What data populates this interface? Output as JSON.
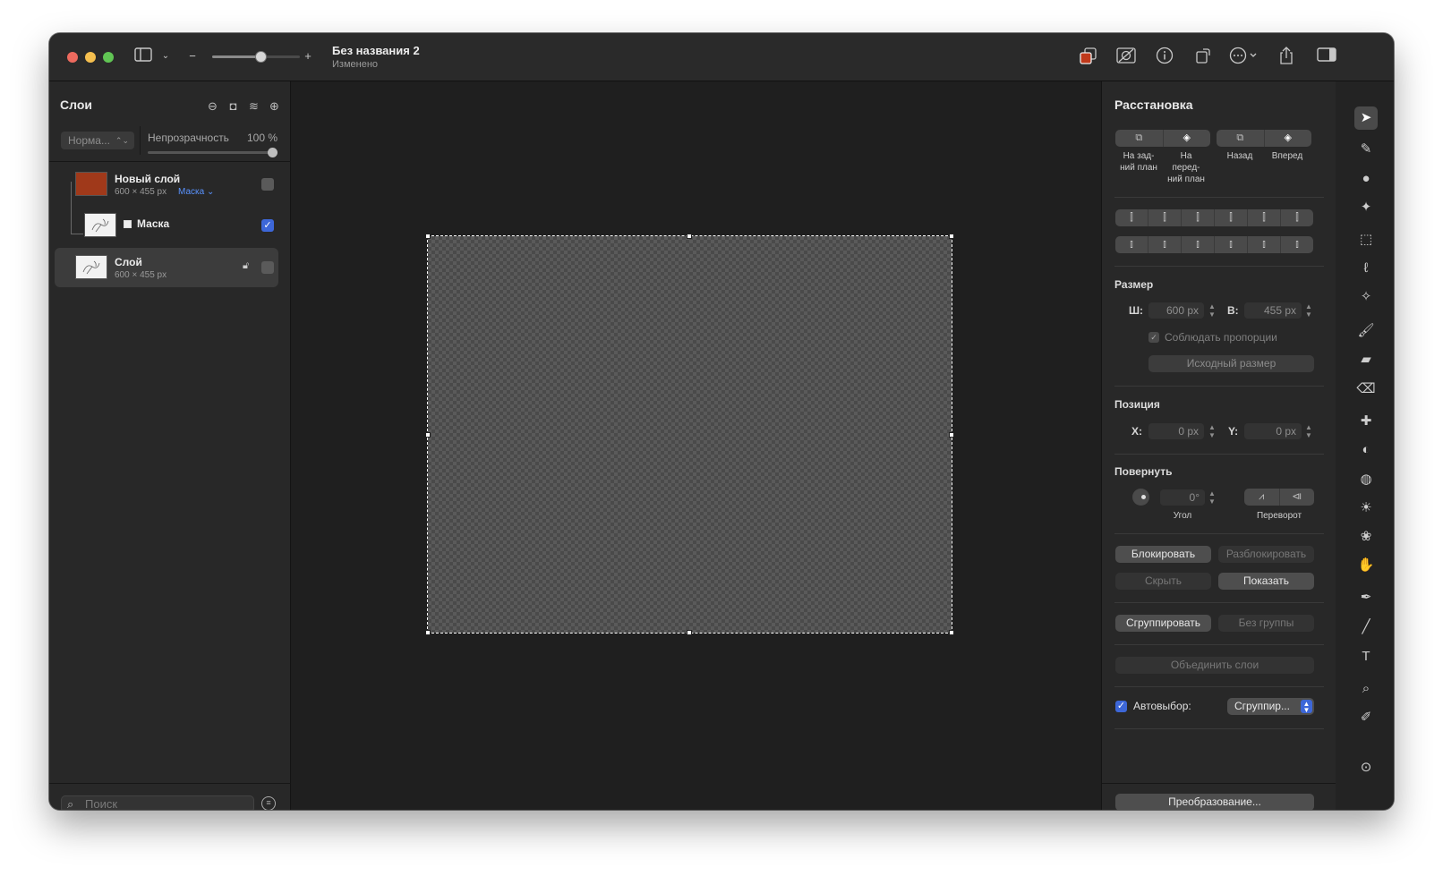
{
  "window": {
    "title": "Без названия 2",
    "subtitle": "Изменено"
  },
  "toolbar": {
    "zoom_minus": "−",
    "zoom_plus": "+",
    "zoom_level": 0.55,
    "icons": [
      "sidebar-icon",
      "chevron-down-icon",
      "color-icon",
      "adjust-image-icon",
      "info-icon",
      "rotate-icon",
      "more-icon",
      "share-icon",
      "inspector-icon"
    ]
  },
  "layers_panel": {
    "title": "Слои",
    "blend_mode": "Норма...",
    "opacity_label": "Непрозрачность",
    "opacity_value": "100 %",
    "layers": [
      {
        "name": "Новый слой",
        "size": "600 × 455 px",
        "mask_link": "Маска",
        "color": "#a0391a"
      },
      {
        "name": "Маска",
        "mask_icon": "◘"
      },
      {
        "name": "Слой",
        "size": "600 × 455 px"
      }
    ],
    "search_placeholder": "Поиск"
  },
  "arrange_panel": {
    "title": "Расстановка",
    "order_buttons": [
      {
        "label": "На зад-\nний план"
      },
      {
        "label": "На\nперед-\nний план"
      },
      {
        "label": "Назад"
      },
      {
        "label": "Вперед"
      }
    ],
    "size": {
      "label": "Размер",
      "w_label": "Ш:",
      "w_value": "600 px",
      "h_label": "В:",
      "h_value": "455 px",
      "keep_proportions": "Соблюдать пропорции",
      "original_size": "Исходный размер"
    },
    "position": {
      "label": "Позиция",
      "x_label": "X:",
      "x_value": "0 px",
      "y_label": "Y:",
      "y_value": "0 px"
    },
    "rotate": {
      "label": "Повернуть",
      "angle_value": "0°",
      "angle_caption": "Угол",
      "flip_caption": "Переворот"
    },
    "buttons": {
      "lock": "Блокировать",
      "unlock": "Разблокировать",
      "hide": "Скрыть",
      "show": "Показать",
      "group": "Сгруппировать",
      "ungroup": "Без группы",
      "merge": "Объединить слои",
      "transform": "Преобразование..."
    },
    "auto_select": {
      "label": "Автовыбор:",
      "value": "Сгруппир..."
    }
  },
  "tools": [
    "arrow-tool-icon",
    "brush-shape-icon",
    "color-blend-icon",
    "sparkle-icon",
    "rect-select-icon",
    "lasso-icon",
    "magic-select-icon",
    "paint-brush-icon",
    "bucket-icon",
    "eraser-icon",
    "bandage-icon",
    "clone-icon",
    "blur-icon",
    "sun-icon",
    "sponge-icon",
    "smudge-icon",
    "pen-icon",
    "line-icon",
    "text-icon",
    "zoom-icon",
    "eyedropper-icon",
    "more-tools-icon"
  ]
}
